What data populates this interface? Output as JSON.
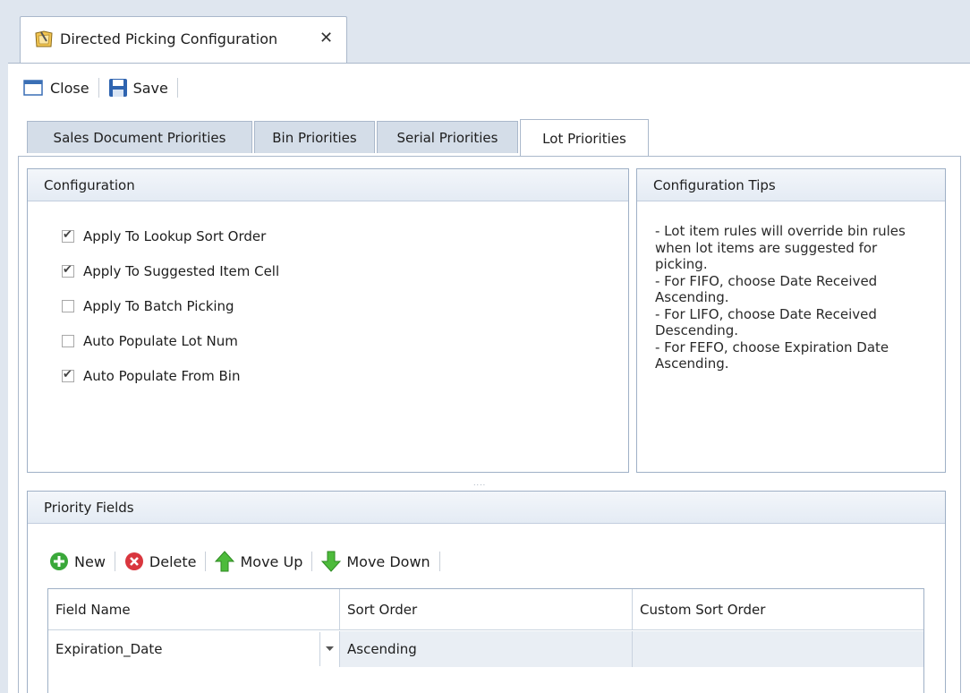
{
  "doc_tab": {
    "title": "Directed Picking Configuration",
    "close_glyph": "✕"
  },
  "toolbar": {
    "close_label": "Close",
    "save_label": "Save"
  },
  "tabs": [
    {
      "label": "Sales Document Priorities",
      "active": false
    },
    {
      "label": "Bin Priorities",
      "active": false
    },
    {
      "label": "Serial Priorities",
      "active": false
    },
    {
      "label": "Lot Priorities",
      "active": true
    }
  ],
  "configuration": {
    "title": "Configuration",
    "options": [
      {
        "label": "Apply To Lookup Sort Order",
        "checked": true
      },
      {
        "label": "Apply To Suggested Item Cell",
        "checked": true
      },
      {
        "label": "Apply To Batch Picking",
        "checked": false
      },
      {
        "label": "Auto Populate Lot Num",
        "checked": false
      },
      {
        "label": "Auto Populate From Bin",
        "checked": true
      }
    ]
  },
  "tips": {
    "title": "Configuration Tips",
    "text": "- Lot item rules will override bin rules when lot items are suggested for picking.\n- For FIFO, choose Date Received Ascending.\n- For LIFO, choose Date Received Descending.\n- For FEFO, choose Expiration Date Ascending."
  },
  "splitter": "....",
  "priority": {
    "title": "Priority Fields",
    "toolbar": {
      "new": "New",
      "delete": "Delete",
      "move_up": "Move Up",
      "move_down": "Move Down"
    },
    "columns": [
      "Field Name",
      "Sort Order",
      "Custom Sort Order"
    ],
    "rows": [
      {
        "field_name": "Expiration_Date",
        "sort_order": "Ascending",
        "custom_sort_order": ""
      }
    ]
  },
  "colors": {
    "accent_bg": "#dfe6ef",
    "panel_border": "#9fb0c6",
    "selected_row": "#e9eef4"
  }
}
